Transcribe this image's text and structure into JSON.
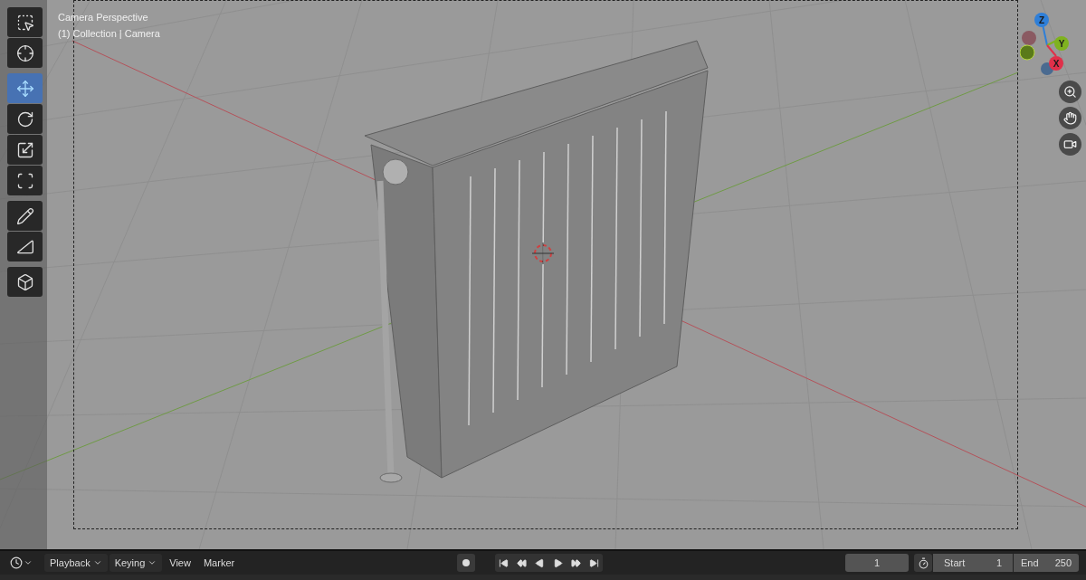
{
  "viewport": {
    "overlay_lines": [
      "Camera Perspective",
      "(1) Collection | Camera"
    ]
  },
  "tool_groups": [
    [
      {
        "kind": "select",
        "selected": false
      },
      {
        "kind": "cursor",
        "selected": false
      }
    ],
    [
      {
        "kind": "move",
        "selected": true
      },
      {
        "kind": "rotate",
        "selected": false
      },
      {
        "kind": "scale",
        "selected": false
      },
      {
        "kind": "transform",
        "selected": false
      }
    ],
    [
      {
        "kind": "annotate",
        "selected": false
      },
      {
        "kind": "measure",
        "selected": false
      }
    ],
    [
      {
        "kind": "add-cube",
        "selected": false
      }
    ]
  ],
  "gizmo": {
    "axes": [
      {
        "label": "Z",
        "color": "#2f7fd8"
      },
      {
        "label": "Y",
        "color": "#7fb21f"
      },
      {
        "label": "X",
        "color": "#e0304a"
      }
    ]
  },
  "nav_buttons": [
    {
      "kind": "zoom"
    },
    {
      "kind": "pan"
    },
    {
      "kind": "camera"
    }
  ],
  "timeline": {
    "menus": [
      {
        "label": "Playback",
        "dropdown": true
      },
      {
        "label": "Keying",
        "dropdown": true
      },
      {
        "label": "View",
        "dropdown": false
      },
      {
        "label": "Marker",
        "dropdown": false
      }
    ],
    "current_frame": "1",
    "start_label": "Start",
    "start": "1",
    "end_label": "End",
    "end": "250"
  }
}
